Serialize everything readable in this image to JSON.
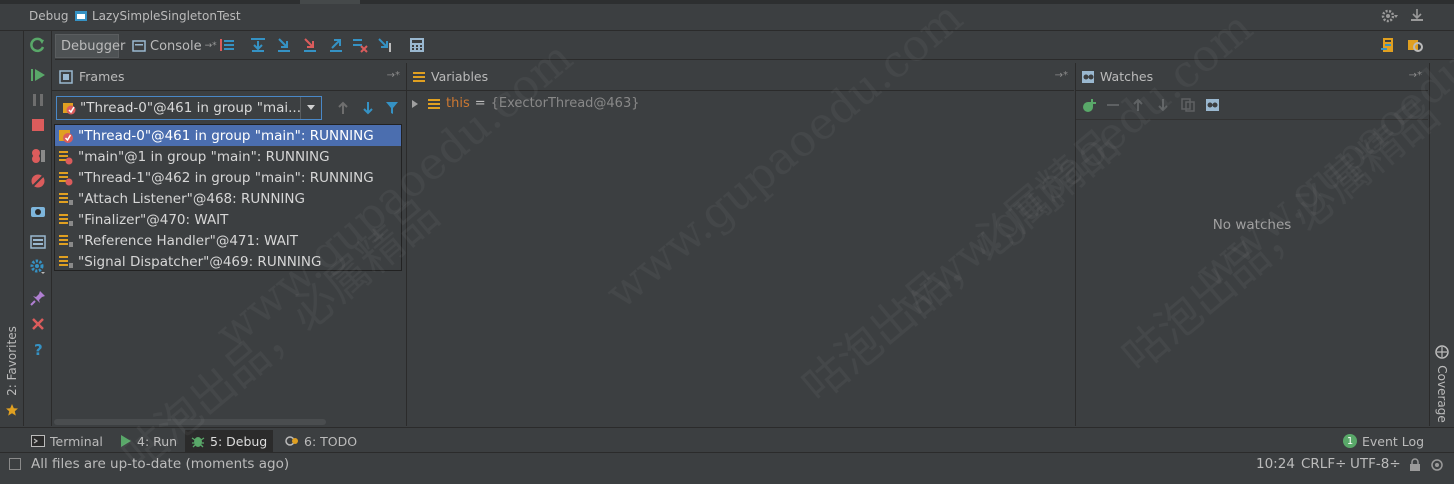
{
  "window": {
    "debug_label": "Debug",
    "config_name": "LazySimpleSingletonTest"
  },
  "toolbar": {
    "tabs": [
      {
        "label": "Debugger"
      },
      {
        "label": "Console"
      }
    ]
  },
  "frames": {
    "title": "Frames",
    "selected_thread": "\"Thread-0\"@461 in group \"mai...",
    "threads": [
      {
        "label": "\"Thread-0\"@461 in group \"main\": RUNNING",
        "selected": true
      },
      {
        "label": "\"main\"@1 in group \"main\": RUNNING"
      },
      {
        "label": "\"Thread-1\"@462 in group \"main\": RUNNING"
      },
      {
        "label": "\"Attach Listener\"@468: RUNNING"
      },
      {
        "label": "\"Finalizer\"@470: WAIT"
      },
      {
        "label": "\"Reference Handler\"@471: WAIT"
      },
      {
        "label": "\"Signal Dispatcher\"@469: RUNNING"
      }
    ]
  },
  "variables": {
    "title": "Variables",
    "rows": [
      {
        "name": "this",
        "eq": "=",
        "value": "{ExectorThread@463}"
      }
    ]
  },
  "watches": {
    "title": "Watches",
    "empty_text": "No watches"
  },
  "left_strip": {
    "favorites": "2: Favorites"
  },
  "right_strip": {
    "coverage": "Coverage"
  },
  "tool_windows": [
    {
      "label": "Terminal",
      "icon": "terminal-icon"
    },
    {
      "label": "4: Run",
      "icon": "run-icon"
    },
    {
      "label": "5: Debug",
      "icon": "debug-bug-icon",
      "active": true
    },
    {
      "label": "6: TODO",
      "icon": "todo-icon"
    }
  ],
  "event_log": {
    "label": "Event Log",
    "count": "1"
  },
  "status": {
    "message": "All files are up-to-date (moments ago)",
    "position": "10:24",
    "line_sep": "CRLF÷",
    "encoding": "UTF-8÷"
  },
  "watermark": {
    "text_cn": "咕泡出品，必属精品",
    "text_url": "www.gupaoedu.com"
  },
  "colors": {
    "bg": "#3c3f41",
    "panel_dark": "#2b2b2b",
    "selection": "#4b6eaf",
    "accent_green": "#59a869",
    "accent_red": "#db5c5c",
    "accent_blue": "#3592c4",
    "keyword_this": "#cc7832"
  }
}
